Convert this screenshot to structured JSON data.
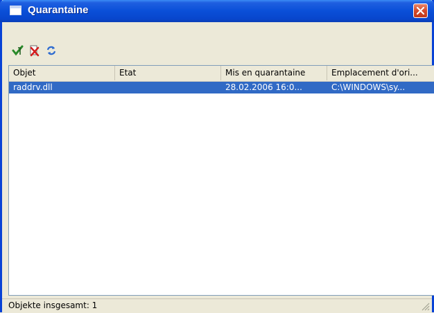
{
  "window": {
    "title": "Quarantaine",
    "close_icon": "close-icon",
    "title_icon": "window-icon"
  },
  "toolbar": {
    "buttons": [
      {
        "name": "restore-icon",
        "color": "#2a8a2a"
      },
      {
        "name": "delete-icon",
        "color": "#d41c1c"
      },
      {
        "name": "refresh-icon",
        "color": "#2c6ad0"
      }
    ]
  },
  "list": {
    "columns": [
      "Objet",
      "Etat",
      "Mis en quarantaine",
      "Emplacement d'ori..."
    ],
    "rows": [
      {
        "objet": "raddrv.dll",
        "etat": "",
        "date": "28.02.2006 16:0...",
        "emplacement": "C:\\WINDOWS\\sy..."
      }
    ],
    "selected_color": "#316ac5"
  },
  "status": {
    "text": "Objekte insgesamt: 1"
  }
}
